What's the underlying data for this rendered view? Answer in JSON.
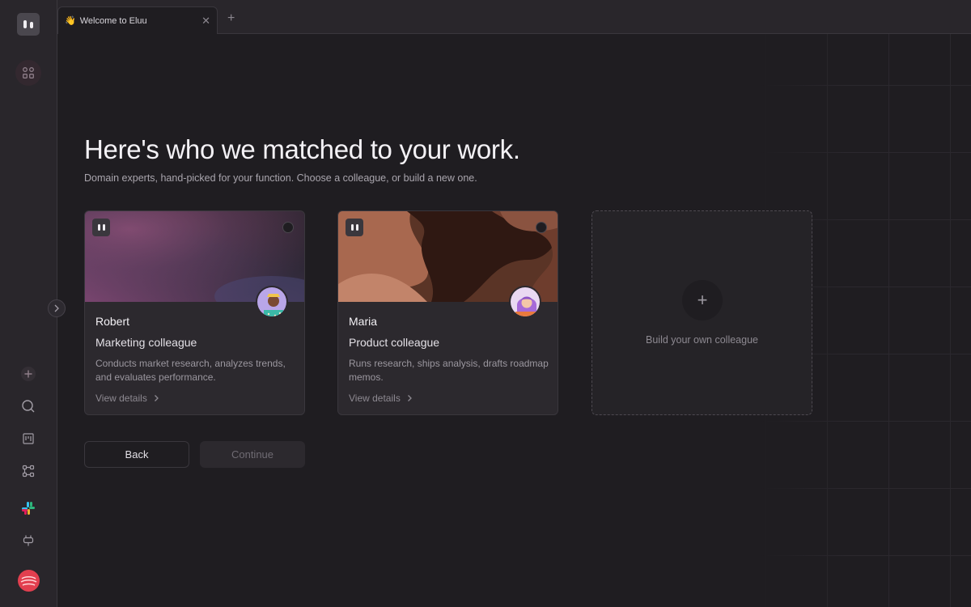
{
  "tabs": [
    {
      "emoji": "👋",
      "title": "Welcome to Eluu"
    }
  ],
  "sidebar": {
    "items": [
      {
        "icon": "grid-icon",
        "active": true
      },
      {
        "icon": "plus-icon"
      },
      {
        "icon": "search-icon"
      },
      {
        "icon": "board-icon"
      },
      {
        "icon": "workflow-icon"
      },
      {
        "icon": "slack-icon"
      },
      {
        "icon": "plug-icon"
      }
    ]
  },
  "main": {
    "headline": "Here's who we matched to your work.",
    "subline": "Domain experts, hand-picked for your function. Choose a colleague, or build a new one.",
    "cards": [
      {
        "name": "Robert",
        "role": "Marketing colleague",
        "description": "Conducts market research, analyzes trends, and evaluates performance.",
        "details_label": "View details"
      },
      {
        "name": "Maria",
        "role": "Product colleague",
        "description": "Runs research, ships analysis, drafts roadmap memos.",
        "details_label": "View details"
      }
    ],
    "build_label": "Build your own colleague",
    "back_label": "Back",
    "continue_label": "Continue"
  },
  "colors": {
    "background": "#1f1d21",
    "sidebar": "#29262b",
    "card": "#2c292e",
    "accent_red": "#e23f4f"
  }
}
